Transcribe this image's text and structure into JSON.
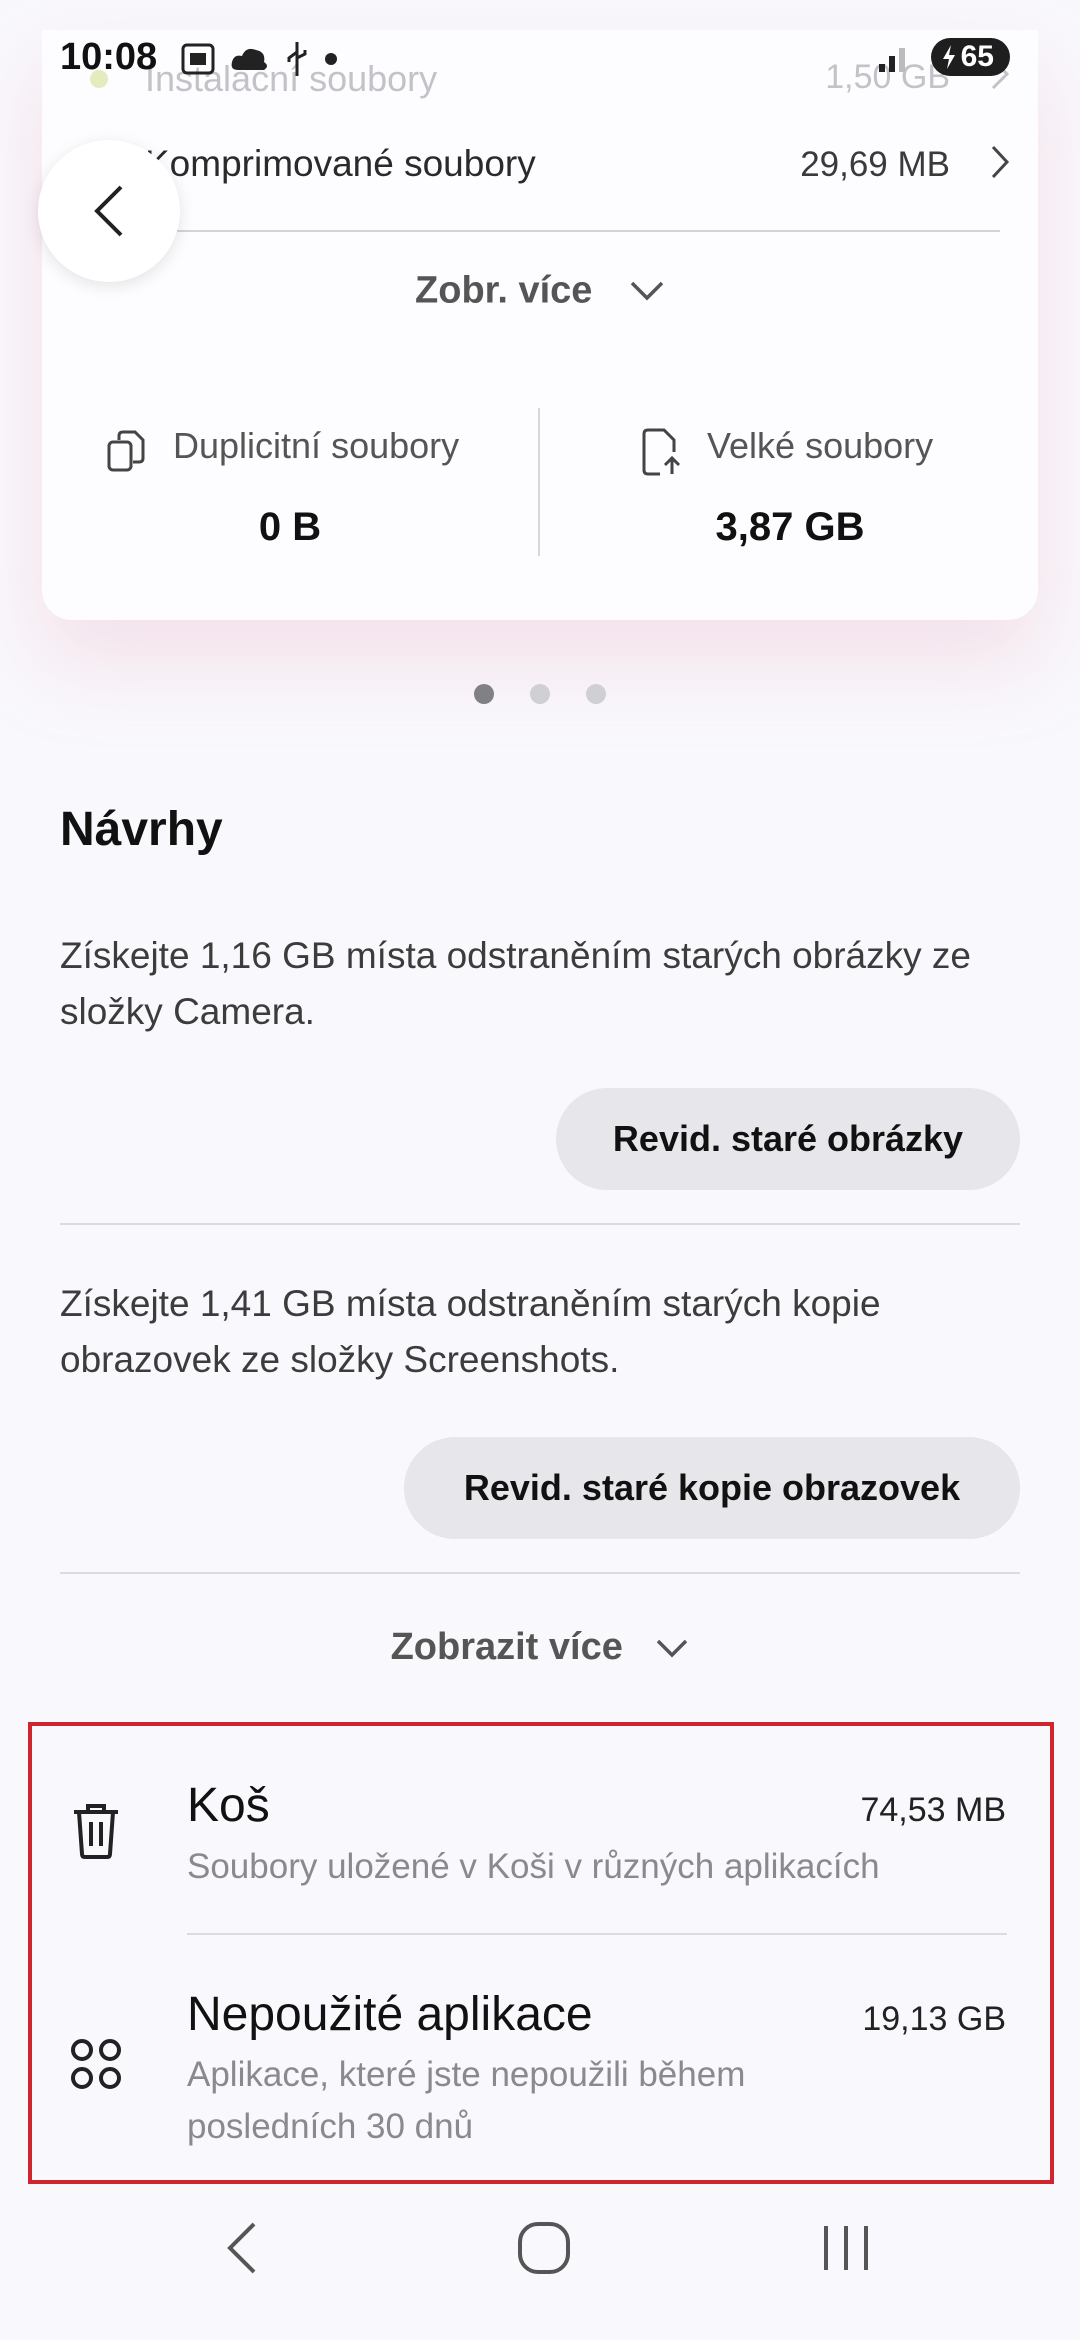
{
  "status_bar": {
    "time": "10:08",
    "battery": "65",
    "icons": [
      "screenshot-icon",
      "cloud-icon",
      "usb-icon",
      "dot-icon",
      "signal-icon",
      "battery-charging-icon"
    ]
  },
  "storage_card": {
    "partial_row": {
      "label": "Instalační soubory",
      "size": "1,50 GB"
    },
    "compressed_row": {
      "label": "Komprimované soubory",
      "size": "29,69 MB"
    },
    "show_more_label": "Zobr. více",
    "duplicates": {
      "label": "Duplicitní soubory",
      "value": "0 B"
    },
    "large_files": {
      "label": "Velké soubory",
      "value": "3,87 GB"
    }
  },
  "pager": {
    "count": 3,
    "active": 0
  },
  "suggestions": {
    "title": "Návrhy",
    "items": [
      {
        "text": "Získejte 1,16 GB místa odstraněním starých obrázky ze složky Camera.",
        "button": "Revid. staré obrázky"
      },
      {
        "text": "Získejte 1,41 GB místa odstraněním starých kopie obrazovek ze složky Screenshots.",
        "button": "Revid. staré kopie obrazovek"
      }
    ],
    "show_more_label": "Zobrazit více"
  },
  "list": [
    {
      "title": "Koš",
      "subtitle": "Soubory uložené v Koši v různých aplikacích",
      "size": "74,53 MB",
      "icon": "trash-icon"
    },
    {
      "title": "Nepoužité aplikace",
      "subtitle": "Aplikace, které jste nepoužili během posledních 30 dnů",
      "size": "19,13 GB",
      "icon": "apps-grid-icon"
    }
  ],
  "colors": {
    "highlight": "#d0242f",
    "background": "#f9f8fc",
    "pill": "#e7e6ea"
  }
}
